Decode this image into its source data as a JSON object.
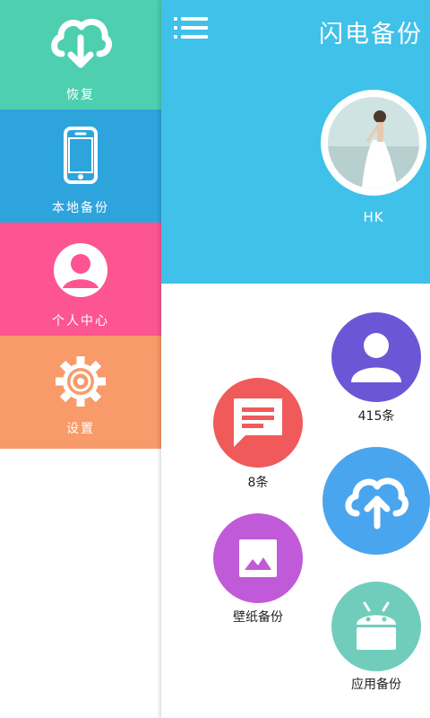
{
  "sidebar": {
    "items": [
      {
        "label": "恢复",
        "icon": "cloud-download-icon",
        "color": "#4dcfb0"
      },
      {
        "label": "本地备份",
        "icon": "phone-icon",
        "color": "#2ea4dd"
      },
      {
        "label": "个人中心",
        "icon": "person-icon",
        "color": "#fc5591"
      },
      {
        "label": "设置",
        "icon": "gear-icon",
        "color": "#f89a6a"
      }
    ]
  },
  "header": {
    "title": "闪电备份",
    "menu_icon": "menu-icon",
    "username": "HK",
    "color": "#3fc1e9"
  },
  "actions": {
    "contacts": {
      "label": "415条",
      "icon": "person-icon",
      "color": "#6b57d6"
    },
    "sms": {
      "label": "8条",
      "icon": "message-icon",
      "color": "#f05a5a"
    },
    "upload": {
      "label": "",
      "icon": "cloud-upload-icon",
      "color": "#4aa5ef"
    },
    "wallpaper": {
      "label": "壁纸备份",
      "icon": "image-icon",
      "color": "#c15ad8"
    },
    "apps": {
      "label": "应用备份",
      "icon": "android-icon",
      "color": "#71cdbb"
    }
  }
}
